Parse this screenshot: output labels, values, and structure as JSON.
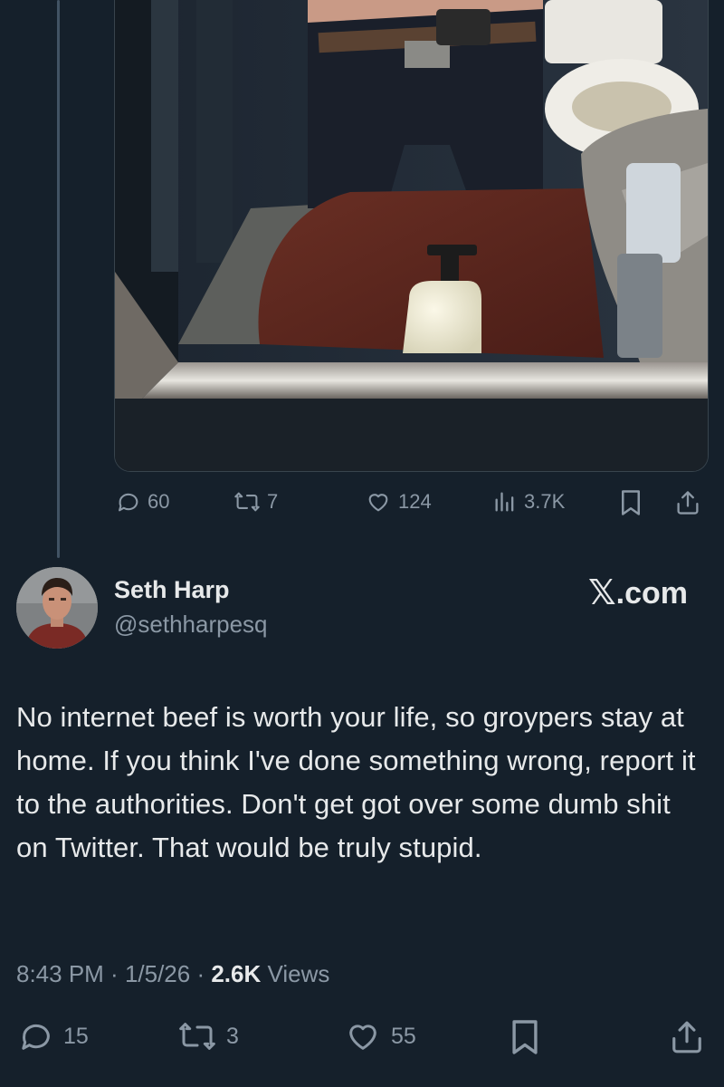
{
  "parent_tweet": {
    "actions": {
      "replies": "60",
      "reposts": "7",
      "likes": "124",
      "views": "3.7K"
    }
  },
  "tweet": {
    "author_name": "Seth Harp",
    "author_handle": "@sethharpesq",
    "source_mark": "𝕏",
    "source_domain": ".com",
    "text": "No internet beef is worth your life, so groypers stay at home. If you think I've done something wrong, report it to the authorities. Don't get got over some dumb shit on Twitter. That would be truly stupid.",
    "time": "8:43 PM",
    "separator": " · ",
    "date": "1/5/26",
    "views_count": "2.6K",
    "views_label": "Views",
    "actions": {
      "replies": "15",
      "reposts": "3",
      "likes": "55"
    }
  },
  "colors": {
    "background": "#15202b",
    "text_primary": "#e7e9ea",
    "text_secondary": "#8b98a5",
    "thread_line": "#425364"
  },
  "icons": [
    "reply-icon",
    "repost-icon",
    "like-icon",
    "views-icon",
    "bookmark-icon",
    "share-icon"
  ]
}
